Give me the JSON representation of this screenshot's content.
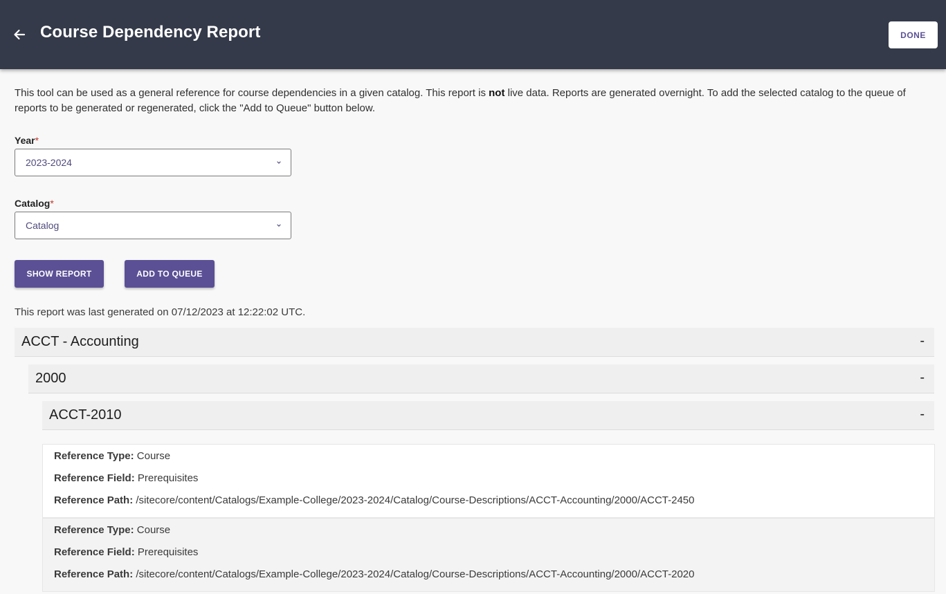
{
  "header": {
    "title": "Course Dependency Report",
    "back_icon": "arrow-left-icon",
    "done_label": "DONE"
  },
  "intro": {
    "text_before": "This tool can be used as a general reference for course dependencies in a given catalog. This report is ",
    "bold": "not",
    "text_after": " live data. Reports are generated overnight. To add the selected catalog to the queue of reports to be generated or regenerated, click the \"Add to Queue\" button below."
  },
  "form": {
    "year_label": "Year",
    "year_value": "2023-2024",
    "catalog_label": "Catalog",
    "catalog_value": "Catalog",
    "required_mark": "*"
  },
  "actions": {
    "show_report": "SHOW REPORT",
    "add_to_queue": "ADD TO QUEUE"
  },
  "status": {
    "last_generated": "This report was last generated on 07/12/2023 at 12:22:02 UTC."
  },
  "report": {
    "department": "ACCT - Accounting",
    "level": "2000",
    "course": "ACCT-2010",
    "toggle": "-",
    "labels": {
      "type": "Reference Type:",
      "field": "Reference Field:",
      "path": "Reference Path:"
    },
    "references": [
      {
        "type": "Course",
        "field": "Prerequisites",
        "path": "/sitecore/content/Catalogs/Example-College/2023-2024/Catalog/Course-Descriptions/ACCT-Accounting/2000/ACCT-2450"
      },
      {
        "type": "Course",
        "field": "Prerequisites",
        "path": "/sitecore/content/Catalogs/Example-College/2023-2024/Catalog/Course-Descriptions/ACCT-Accounting/2000/ACCT-2020"
      }
    ]
  },
  "colors": {
    "header_bg": "#343a4a",
    "accent": "#5b5095",
    "page_bg": "#f8f8f8",
    "required": "#c0392b"
  }
}
